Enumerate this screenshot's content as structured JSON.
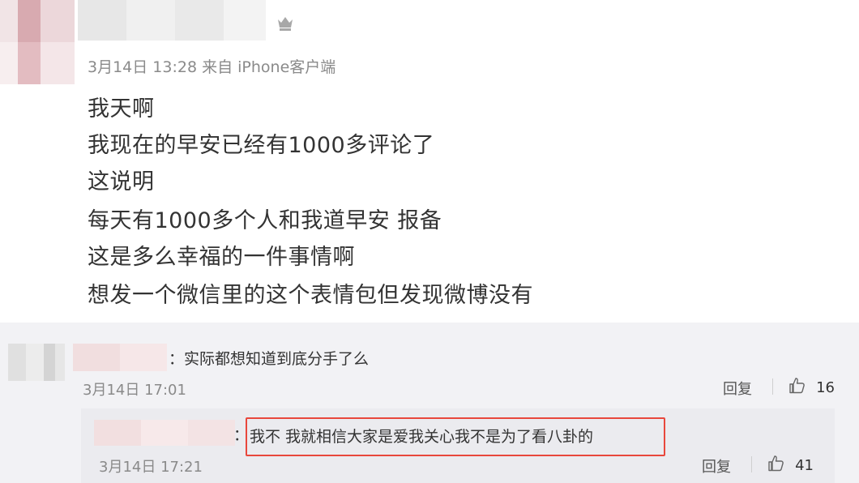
{
  "post": {
    "timestamp_source": "3月14日 13:28 来自 iPhone客户端",
    "lines": [
      "我天啊",
      "我现在的早安已经有1000多评论了",
      "这说明",
      "每天有1000多个人和我道早安 报备",
      "这是多么幸福的一件事情啊",
      "想发一个微信里的这个表情包但发现微博没有"
    ],
    "crown_icon": "crown-icon"
  },
  "comment": {
    "text": "：实际都想知道到底分手了么",
    "time": "3月14日 17:01",
    "reply_label": "回复",
    "like_count": "16"
  },
  "reply": {
    "separator": "：",
    "text": "我不 我就相信大家是爱我关心我不是为了看八卦的",
    "time": "3月14日 17:21",
    "reply_label": "回复",
    "like_count": "41"
  },
  "colors": {
    "highlight_border": "#e8473c",
    "meta_text": "#8a8a8a",
    "comment_bg": "#f2f2f5"
  }
}
